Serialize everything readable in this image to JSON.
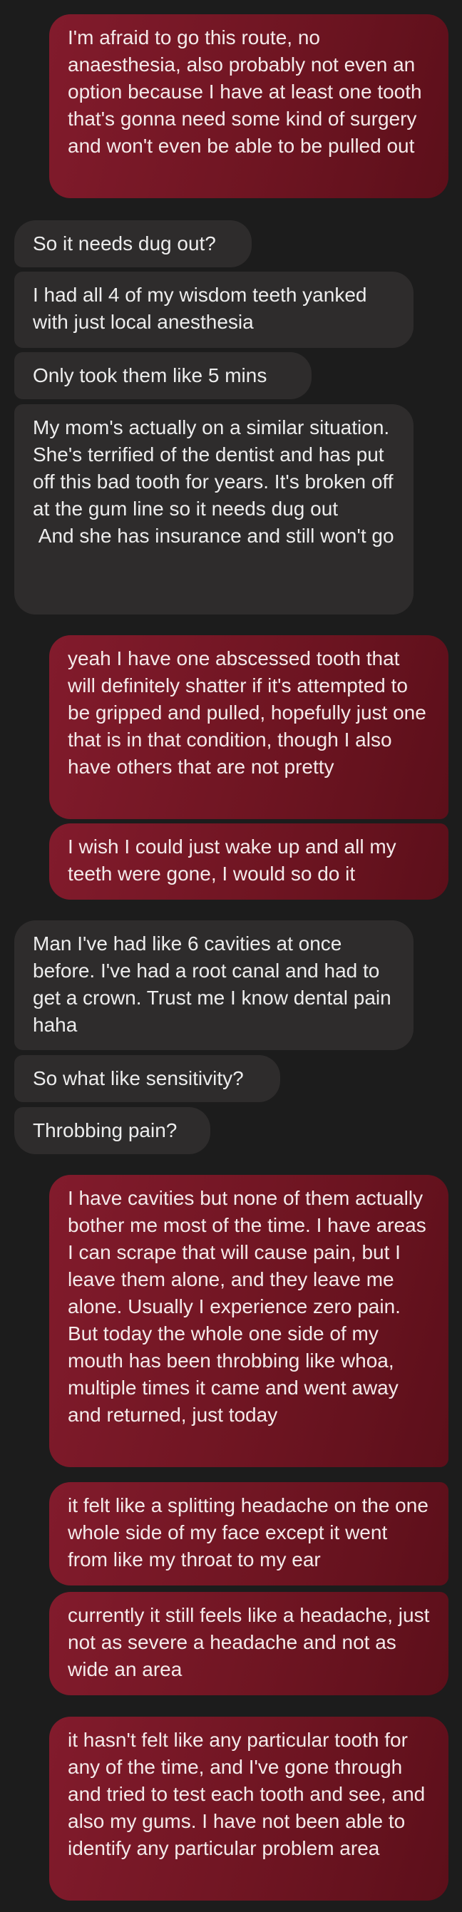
{
  "messages": [
    {
      "direction": "sent",
      "text": "I'm afraid to go this route, no anaesthesia, also probably not even an option because I have at least one tooth that's gonna need some kind of surgery and won't even be able to be pulled out"
    },
    {
      "direction": "received",
      "text": "So it needs dug out?"
    },
    {
      "direction": "received",
      "text": "I had all 4 of my wisdom teeth yanked with just local anesthesia"
    },
    {
      "direction": "received",
      "text": "Only took them like 5 mins"
    },
    {
      "direction": "received",
      "text": "My mom's actually on a similar situation. She's terrified of the dentist and has put off this bad tooth for years. It's broken off at the gum line so it needs dug out\n And she has insurance and still won't go"
    },
    {
      "direction": "sent",
      "text": "yeah I have one abscessed tooth that will definitely shatter if it's attempted to be gripped and pulled, hopefully just one that is in that condition, though I also have others that are not pretty"
    },
    {
      "direction": "sent",
      "text": "I wish I could just wake up and all my teeth were gone, I would so do it"
    },
    {
      "direction": "received",
      "text": "Man I've had like 6 cavities at once before. I've had a root canal and had to get a crown. Trust me I know dental pain haha"
    },
    {
      "direction": "received",
      "text": "So what like sensitivity?"
    },
    {
      "direction": "received",
      "text": "Throbbing pain?"
    },
    {
      "direction": "sent",
      "text": "I have cavities but none of them actually bother me most of the time. I have areas I can scrape that will cause pain, but I leave them alone, and they leave me alone. Usually I experience zero pain. But today the whole one side of my mouth has been throbbing like whoa, multiple times it came and went away and returned, just today"
    },
    {
      "direction": "sent",
      "text": "it felt like a splitting headache on the one whole side of my face except it went from like my throat to my ear"
    },
    {
      "direction": "sent",
      "text": "currently it still feels like a headache, just not as severe a headache and not as wide an area"
    },
    {
      "direction": "sent",
      "text": "it hasn't felt like any particular tooth for any of the time, and I've gone through and tried to test each tooth and see, and also my gums. I have not been able to identify any particular problem area"
    }
  ]
}
